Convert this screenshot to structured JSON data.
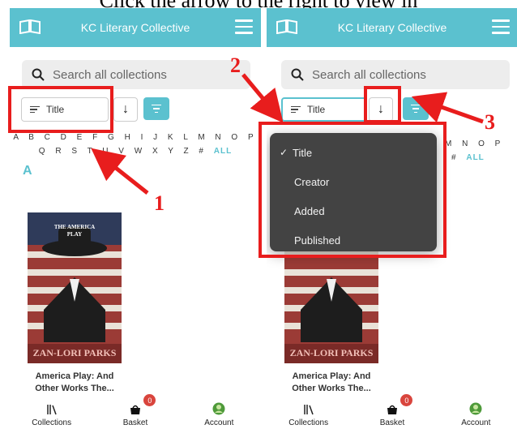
{
  "caption": "Click the arrow to the right to view in",
  "app": {
    "title": "KC Literary Collective",
    "brand_color": "#5bc1cf",
    "icons": [
      "book-icon",
      "menu-icon"
    ]
  },
  "search": {
    "placeholder": "Search all collections"
  },
  "sort": {
    "selected": "Title",
    "direction_glyph": "↓"
  },
  "alphabet": {
    "row1": "A B C D E F G H I J K L M N O P",
    "row2": "Q R S T U V W X Y Z #",
    "all": "ALL"
  },
  "right_alphabet": {
    "row1": "M N O P",
    "row2": "#",
    "all": "ALL"
  },
  "section_letter": "A",
  "book": {
    "cover_band_top": "THE AMERICA PLAY",
    "cover_author": "ZAN-LORI PARKS",
    "title_line1": "America Play: And",
    "title_line2": "Other Works The..."
  },
  "dropdown": {
    "check": "✓",
    "options": [
      "Title",
      "Creator",
      "Added",
      "Published"
    ]
  },
  "nav": {
    "collections": "Collections",
    "basket": "Basket",
    "basket_count": "0",
    "account": "Account"
  },
  "annotations": {
    "n1": "1",
    "n2": "2",
    "n3": "3",
    "color": "#e81d1d"
  }
}
